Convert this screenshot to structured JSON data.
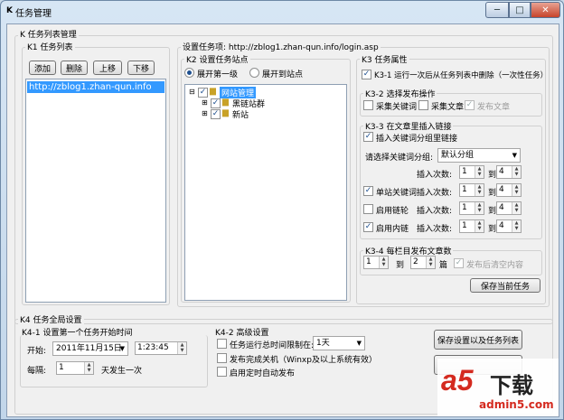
{
  "window": {
    "title": "任务管理",
    "icon": "K",
    "buttons": {
      "minimize": "─",
      "maximize": "□",
      "close": "✕"
    }
  },
  "main_group": "K 任务列表管理",
  "task_list": {
    "label": "K1 任务列表",
    "buttons": {
      "add": "添加",
      "delete": "删除",
      "up": "上移",
      "down": "下移"
    },
    "items": [
      "http://zblog1.zhan-qun.info"
    ]
  },
  "task_settings": {
    "label": "设置任务项: http://zblog1.zhan-qun.info/login.asp",
    "sites": {
      "label": "K2 设置任务站点",
      "expand_first": "展开第一级",
      "expand_site": "展开到站点",
      "tree": {
        "root": "网站管理",
        "children": [
          "黑链站群",
          "新站"
        ]
      }
    },
    "properties": {
      "label": "K3 任务属性",
      "k3_1": "K3-1 运行一次后从任务列表中删除（一次性任务）",
      "k3_2": {
        "label": "K3-2 选择发布操作",
        "collect_keywords": "采集关键词",
        "collect_articles": "采集文章",
        "publish_article": "发布文章"
      },
      "k3_3": {
        "label": "K3-3 在文章里插入链接",
        "insert_group_link": "插入关键词分组里链接",
        "select_group_label": "请选择关键词分组:",
        "group_value": "默认分组",
        "insert_count_label": "插入次数:",
        "to_label": "到",
        "rows": [
          {
            "label": "",
            "from": "1",
            "to": "4"
          },
          {
            "label": "单站关键词",
            "from": "1",
            "to": "4"
          },
          {
            "label": "启用链轮",
            "from": "1",
            "to": "4"
          },
          {
            "label": "启用内链",
            "from": "1",
            "to": "4"
          }
        ]
      },
      "k3_4": {
        "label": "K3-4 每栏目发布文章数",
        "from": "1",
        "to_label": "到",
        "to": "2",
        "unit": "篇",
        "clear_after": "发布后清空内容"
      },
      "save_task": "保存当前任务"
    }
  },
  "global": {
    "label": "K4 任务全局设置",
    "k4_1": {
      "label": "K4-1 设置第一个任务开始时间",
      "start_label": "开始:",
      "start_date": "2011年11月15日",
      "start_time": "1:23:45",
      "interval_label": "每隔:",
      "interval_value": "1",
      "interval_unit": "天发生一次"
    },
    "k4_2": {
      "label": "K4-2 高级设置",
      "limit_label": "任务运行总时间限制在:",
      "limit_value": "1天",
      "shutdown": "发布完成关机（Winxp及以上系统有效）",
      "autostart": "启用定时自动发布"
    },
    "save_all": "保存设置以及任务列表"
  },
  "watermark": {
    "logo": "a5",
    "text": "下载",
    "url": "admin5.com"
  }
}
